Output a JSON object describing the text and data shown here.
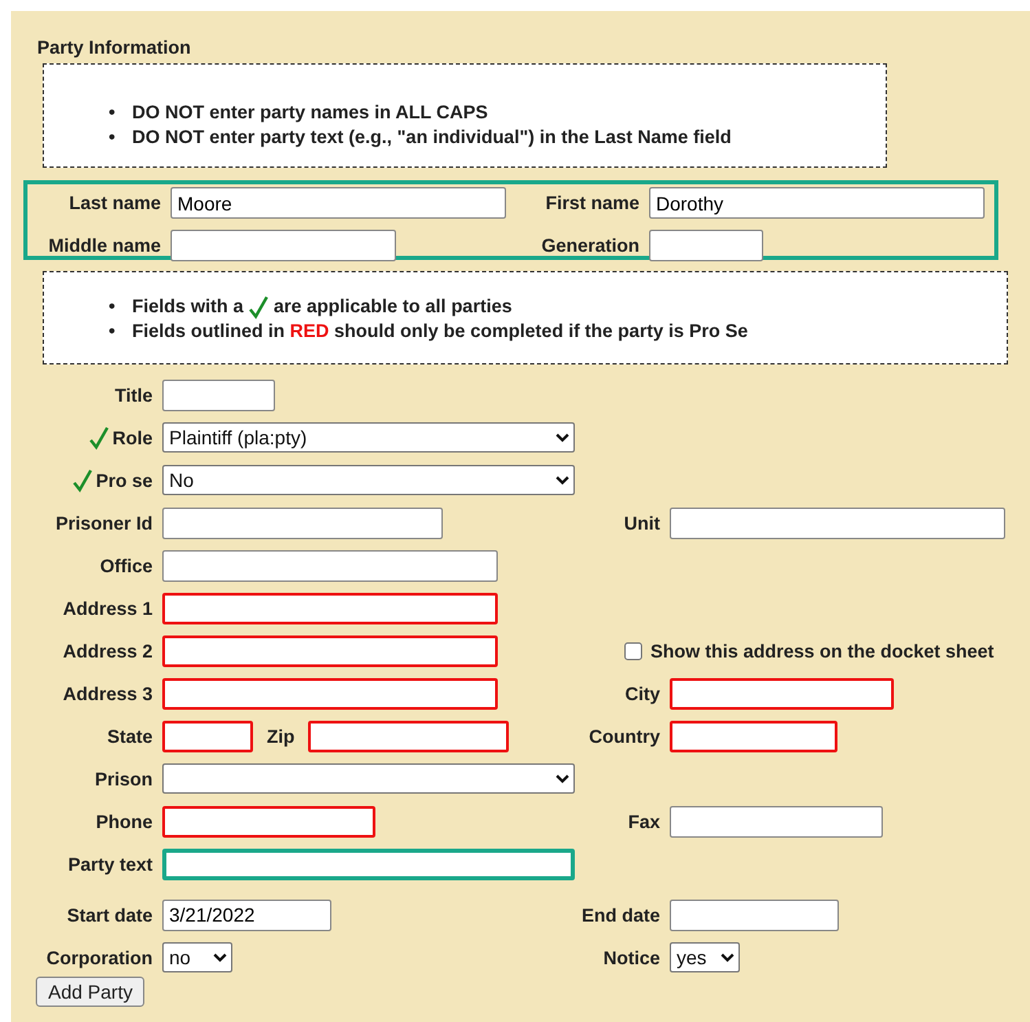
{
  "section_title": "Party Information",
  "notice_caps": [
    {
      "bullet": "•",
      "text": "DO NOT enter party names in ALL CAPS"
    },
    {
      "bullet": "•",
      "text": "DO NOT enter party text (e.g., \"an individual\") in the Last Name field"
    }
  ],
  "name_fields": [
    {
      "label": "Last name",
      "value": "Moore"
    },
    {
      "label": "First name",
      "value": "Dorothy"
    },
    {
      "label": "Middle name"
    },
    {
      "label": "Generation"
    }
  ],
  "notice_fields": {
    "check_line": {
      "bullet": "•",
      "before": "Fields with a",
      "after": "are applicable to all parties"
    },
    "red_line": {
      "bullet": "•",
      "before": "Fields outlined in",
      "highlight": "RED",
      "after": "should only be completed if the party is Pro Se"
    }
  },
  "rows": [
    {
      "left": [
        {
          "kind": "text",
          "label": "Title",
          "applicable_to_all": false,
          "pro_se_only": false,
          "highlighted": false
        }
      ],
      "right": []
    },
    {
      "left": [
        {
          "kind": "select",
          "label": "Role",
          "value": "Plaintiff (pla:pty)",
          "applicable_to_all": true,
          "pro_se_only": false,
          "highlighted": false
        }
      ],
      "right": []
    },
    {
      "left": [
        {
          "kind": "select",
          "label": "Pro se",
          "value": "No",
          "applicable_to_all": true,
          "pro_se_only": false,
          "highlighted": false
        }
      ],
      "right": []
    },
    {
      "left": [
        {
          "kind": "text",
          "label": "Prisoner Id",
          "applicable_to_all": false,
          "pro_se_only": false,
          "highlighted": false
        }
      ],
      "right": [
        {
          "kind": "text",
          "label": "Unit",
          "applicable_to_all": false,
          "pro_se_only": false,
          "highlighted": false
        }
      ]
    },
    {
      "left": [
        {
          "kind": "text",
          "label": "Office",
          "applicable_to_all": false,
          "pro_se_only": false,
          "highlighted": false
        }
      ],
      "right": []
    },
    {
      "left": [
        {
          "kind": "text",
          "label": "Address 1",
          "applicable_to_all": false,
          "pro_se_only": true,
          "highlighted": false
        }
      ],
      "right": []
    },
    {
      "left": [
        {
          "kind": "text",
          "label": "Address 2",
          "applicable_to_all": false,
          "pro_se_only": true,
          "highlighted": false
        }
      ],
      "right": [
        {
          "kind": "checkbox",
          "label": "Show this address on the docket sheet",
          "checked": false
        }
      ]
    },
    {
      "left": [
        {
          "kind": "text",
          "label": "Address 3",
          "applicable_to_all": false,
          "pro_se_only": true,
          "highlighted": false
        }
      ],
      "right": [
        {
          "kind": "text",
          "label": "City",
          "applicable_to_all": false,
          "pro_se_only": true,
          "highlighted": false
        }
      ]
    },
    {
      "left": [
        {
          "kind": "text",
          "label": "State",
          "applicable_to_all": false,
          "pro_se_only": true,
          "highlighted": false
        },
        {
          "kind": "text",
          "label": "Zip",
          "applicable_to_all": false,
          "pro_se_only": true,
          "highlighted": false
        }
      ],
      "right": [
        {
          "kind": "text",
          "label": "Country",
          "applicable_to_all": false,
          "pro_se_only": true,
          "highlighted": false
        }
      ]
    },
    {
      "left": [
        {
          "kind": "select",
          "label": "Prison",
          "applicable_to_all": false,
          "pro_se_only": false,
          "highlighted": false
        }
      ],
      "right": []
    },
    {
      "left": [
        {
          "kind": "text",
          "label": "Phone",
          "applicable_to_all": false,
          "pro_se_only": true,
          "highlighted": false
        }
      ],
      "right": [
        {
          "kind": "text",
          "label": "Fax",
          "applicable_to_all": false,
          "pro_se_only": false,
          "highlighted": false
        }
      ]
    },
    {
      "left": [
        {
          "kind": "text",
          "label": "Party text",
          "applicable_to_all": false,
          "pro_se_only": false,
          "highlighted": true
        }
      ],
      "right": []
    },
    {
      "left": [
        {
          "kind": "text",
          "label": "Start date",
          "value": "3/21/2022",
          "applicable_to_all": false,
          "pro_se_only": false,
          "highlighted": false
        }
      ],
      "right": [
        {
          "kind": "text",
          "label": "End date",
          "applicable_to_all": false,
          "pro_se_only": false,
          "highlighted": false
        }
      ]
    },
    {
      "left": [
        {
          "kind": "select",
          "label": "Corporation",
          "value": "no",
          "applicable_to_all": false,
          "pro_se_only": false,
          "highlighted": false
        }
      ],
      "right": [
        {
          "kind": "select",
          "label": "Notice",
          "value": "yes",
          "applicable_to_all": false,
          "pro_se_only": false,
          "highlighted": false
        }
      ]
    }
  ],
  "submit_button": "Add Party"
}
